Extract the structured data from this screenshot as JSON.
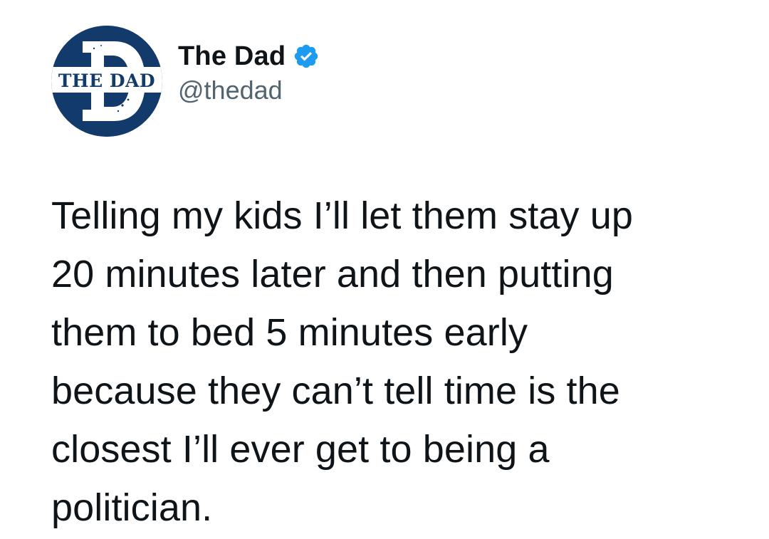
{
  "author": {
    "display_name": "The Dad",
    "handle": "@thedad",
    "verified": true,
    "avatar_text": "THE DAD",
    "avatar_letter": "D",
    "avatar_color": "#123a6b",
    "verified_color": "#1d9bf0"
  },
  "tweet": {
    "text": "Telling my kids I’ll let them stay up\n20 minutes later and then putting\nthem to bed 5 minutes early\nbecause they can’t tell time is the\nclosest I’ll ever get to being a\npolitician."
  }
}
